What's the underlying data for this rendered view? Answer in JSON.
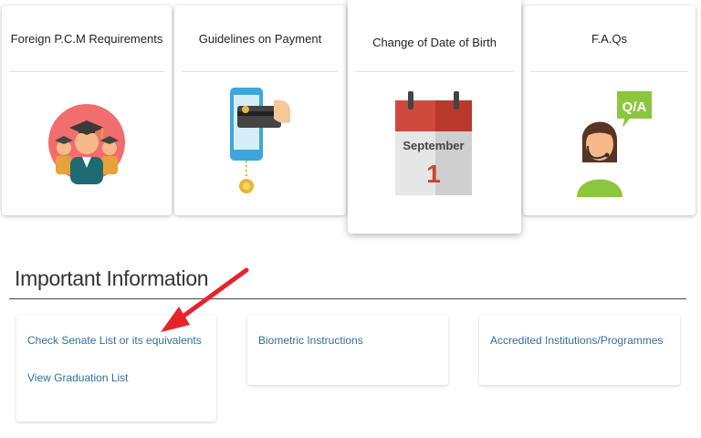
{
  "cards": [
    {
      "title": "Foreign P.C.M Requirements",
      "icon": "graduates-icon"
    },
    {
      "title": "Guidelines on Payment",
      "icon": "mobile-payment-icon"
    },
    {
      "title": "Change of Date of Birth",
      "icon": "calendar-icon",
      "calendar_month": "September",
      "calendar_day": "1"
    },
    {
      "title": "F.A.Qs",
      "icon": "support-agent-icon",
      "bubble_text": "Q/A"
    }
  ],
  "section": {
    "title": "Important Information"
  },
  "info_boxes": [
    {
      "links": [
        "Check Senate List or its equivalents",
        "View Graduation List"
      ]
    },
    {
      "links": [
        "Biometric Instructions"
      ]
    },
    {
      "links": [
        "Accredited Institutions/Programmes"
      ]
    }
  ],
  "colors": {
    "link": "#2f6fa0",
    "annotation_arrow": "#e8222a"
  }
}
